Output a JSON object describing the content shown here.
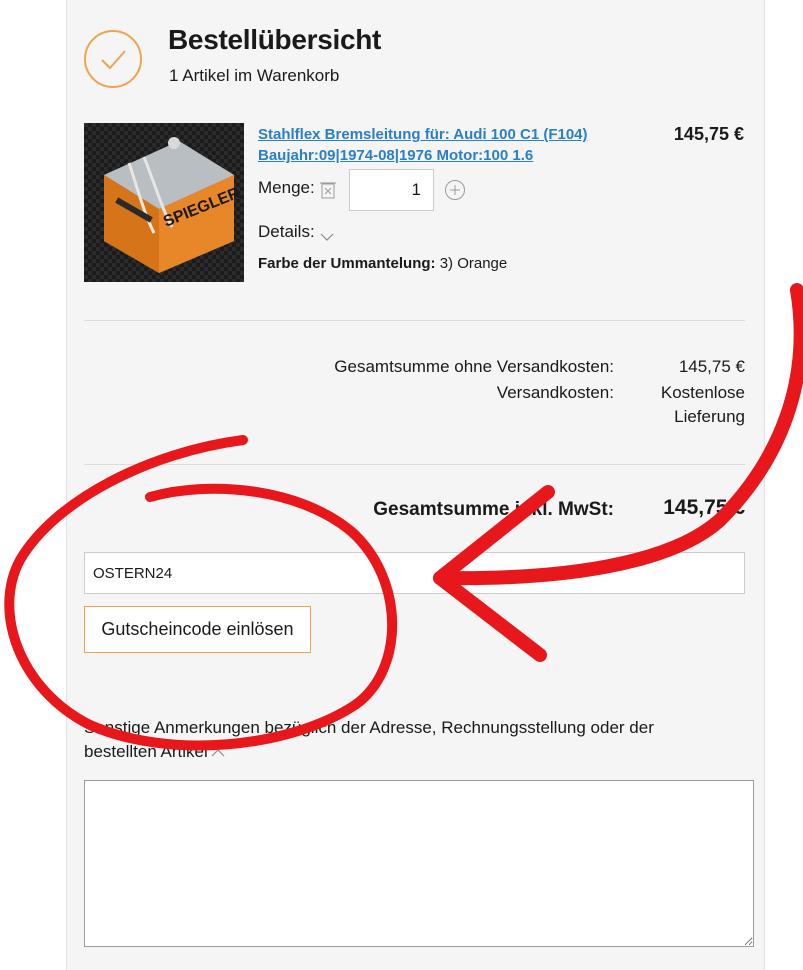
{
  "header": {
    "title": "Bestellübersicht",
    "subtitle": "1 Artikel im Warenkorb",
    "check_icon": "check-circle-icon",
    "accent_color": "#f0a34e"
  },
  "item": {
    "name_line1": "Stahlflex Bremsleitung für: Audi 100 C1 (F104)",
    "name_line2": "Baujahr:09|1974-08|1976 Motor:100 1.6",
    "price": "145,75 €",
    "quantity_label": "Menge:",
    "quantity_value": "1",
    "details_label": "Details:",
    "attribute_label": "Farbe der Ummantelung:",
    "attribute_value": "3) Orange",
    "image_brand": "SPIEGLER",
    "link_color": "#2a7fc9"
  },
  "summary": {
    "subtotal_label": "Gesamtsumme ohne Versandkosten:",
    "subtotal_value": "145,75 €",
    "shipping_label": "Versandkosten:",
    "shipping_value_line1": "Kostenlose",
    "shipping_value_line2": "Lieferung",
    "total_label": "Gesamtsumme inkl. MwSt:",
    "total_value": "145,75 €"
  },
  "coupon": {
    "value": "OSTERN24",
    "button_label": "Gutscheincode einlösen"
  },
  "notes": {
    "label": "Sonstige Anmerkungen bezüglich der Adresse, Rechnungsstellung oder der bestellten Artikel",
    "value": ""
  },
  "annotation": {
    "color": "#e8171c",
    "shapes": [
      "circle",
      "arrow"
    ]
  }
}
